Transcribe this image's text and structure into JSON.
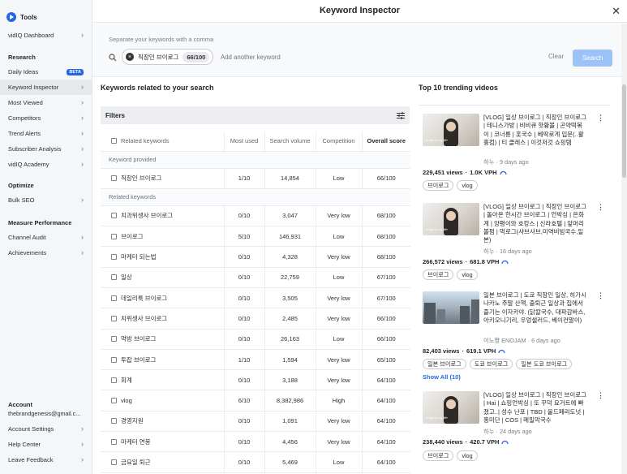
{
  "sidebar": {
    "brand": "Tools",
    "items": [
      {
        "label": "vidIQ Dashboard",
        "chevron": true
      },
      {
        "section": "Research"
      },
      {
        "label": "Daily Ideas",
        "badge": "BETA"
      },
      {
        "label": "Keyword Inspector",
        "chevron": true,
        "active": true
      },
      {
        "label": "Most Viewed",
        "chevron": true
      },
      {
        "label": "Competitors",
        "chevron": true
      },
      {
        "label": "Trend Alerts",
        "chevron": true
      },
      {
        "label": "Subscriber Analysis",
        "chevron": true
      },
      {
        "label": "vidIQ Academy",
        "chevron": true
      },
      {
        "section": "Optimize"
      },
      {
        "label": "Bulk SEO",
        "chevron": true
      },
      {
        "section": "Measure Performance"
      },
      {
        "label": "Channel Audit",
        "chevron": true
      },
      {
        "label": "Achievements",
        "chevron": true
      }
    ],
    "account_label": "Account",
    "account_email": "thebrandgenesis@gmail.c...",
    "footer_items": [
      {
        "label": "Account Settings"
      },
      {
        "label": "Help Center"
      },
      {
        "label": "Leave Feedback"
      }
    ]
  },
  "header": {
    "title": "Keyword Inspector",
    "close": "✕"
  },
  "search": {
    "hint": "Separate your keywords with a comma",
    "chip_text": "직장인 브이로그",
    "chip_count": "66/100",
    "add_placeholder": "Add another keyword",
    "clear": "Clear",
    "search_btn": "Search"
  },
  "keywords": {
    "title": "Keywords related to your search",
    "filters": "Filters",
    "columns": [
      "Related keywords",
      "Most used",
      "Search volume",
      "Competition",
      "Overall score"
    ],
    "provided_label": "Keyword provided",
    "provided": [
      {
        "kw": "직장인 브이로그",
        "mu": "1/10",
        "sv": "14,854",
        "co": "Low",
        "os": "66/100"
      }
    ],
    "related_label": "Related keywords",
    "related": [
      {
        "kw": "치과위생사 브이로그",
        "mu": "0/10",
        "sv": "3,047",
        "co": "Very low",
        "os": "68/100"
      },
      {
        "kw": "브이로그",
        "mu": "5/10",
        "sv": "146,931",
        "co": "Low",
        "os": "68/100"
      },
      {
        "kw": "마케터 되는법",
        "mu": "0/10",
        "sv": "4,328",
        "co": "Very low",
        "os": "68/100"
      },
      {
        "kw": "일상",
        "mu": "0/10",
        "sv": "22,759",
        "co": "Low",
        "os": "67/100"
      },
      {
        "kw": "데일리룩 브이로그",
        "mu": "0/10",
        "sv": "3,505",
        "co": "Very low",
        "os": "67/100"
      },
      {
        "kw": "치위생사 브이로그",
        "mu": "0/10",
        "sv": "2,485",
        "co": "Very low",
        "os": "66/100"
      },
      {
        "kw": "먹방 브이로그",
        "mu": "0/10",
        "sv": "26,163",
        "co": "Low",
        "os": "66/100"
      },
      {
        "kw": "투잡 브이로그",
        "mu": "1/10",
        "sv": "1,594",
        "co": "Very low",
        "os": "65/100"
      },
      {
        "kw": "회계",
        "mu": "0/10",
        "sv": "3,188",
        "co": "Very low",
        "os": "64/100"
      },
      {
        "kw": "vlog",
        "mu": "6/10",
        "sv": "8,382,986",
        "co": "High",
        "os": "64/100"
      },
      {
        "kw": "경영지원",
        "mu": "0/10",
        "sv": "1,091",
        "co": "Very low",
        "os": "64/100"
      },
      {
        "kw": "마케터 연봉",
        "mu": "0/10",
        "sv": "4,456",
        "co": "Very low",
        "os": "64/100"
      },
      {
        "kw": "금요일 퇴근",
        "mu": "0/10",
        "sv": "5,469",
        "co": "Low",
        "os": "64/100"
      }
    ]
  },
  "trending": {
    "title": "Top 10 trending videos",
    "videos": [
      {
        "title": "[VLOG] 일상 브이로그 | 직장인 브이로그 | 테니스가방 | 비비큐 핫황볼 | 곤약떡볶이 | 코너릉 | 홋국수 | 베딱로게 입문(..활흉컴) | 티 클레스 | 이것저것 쇼핑템",
        "channel": "하누",
        "age": "9 days ago",
        "views": "229,451 views",
        "vph": "1.0K VPH",
        "tags": [
          "브이로그",
          "vlog"
        ]
      },
      {
        "title": "[VLOG] 일상 브이로그 | 직장인 브이로그 | 돌아온 한시간 브이로그 | 언박싱 | 은화계 | 양평이와 호캉스 | 신라호텔 | 앞머리 볼펌 | 먹로그(샤브샤브,미역비빔국수,일본)",
        "channel": "하누",
        "age": "16 days ago",
        "views": "266,572 views",
        "vph": "681.8 VPH",
        "tags": [
          "브이로그",
          "vlog"
        ]
      },
      {
        "title": "일본 브이로그 | 도쿄 직장인 일상, 히가시나카노 주말 산책, 출퇴근 일상과 집에서 즐기는 이자카야. (닭칼국수, 대파감바스, 아키오니기리, 우엉샐러드, 베이컨말이)",
        "channel": "이노쨩 ENOJAM",
        "age": "6 days ago",
        "views": "82,403 views",
        "vph": "619.1 VPH",
        "tags": [
          "일본 브이로그",
          "도쿄 브이로그",
          "일본 도쿄 브이로그"
        ],
        "show_all": "Show All (10)"
      },
      {
        "title": "[VLOG] 일상 브이로그 | 직장인 브이로그 | Hai | 쇼핑언박싱 | 또 꾸덕 요거트에 빠졌고..| 성수 난포 | TBD | 올드페리도넛 | 홍미단 | COS | 메밀막국수",
        "channel": "하누",
        "age": "24 days ago",
        "views": "238,440 views",
        "vph": "420.7 VPH",
        "tags": [
          "브이로그",
          "vlog"
        ]
      }
    ]
  },
  "colors": {
    "accent": "#2266e8",
    "search_btn": "#9cc2f7"
  }
}
